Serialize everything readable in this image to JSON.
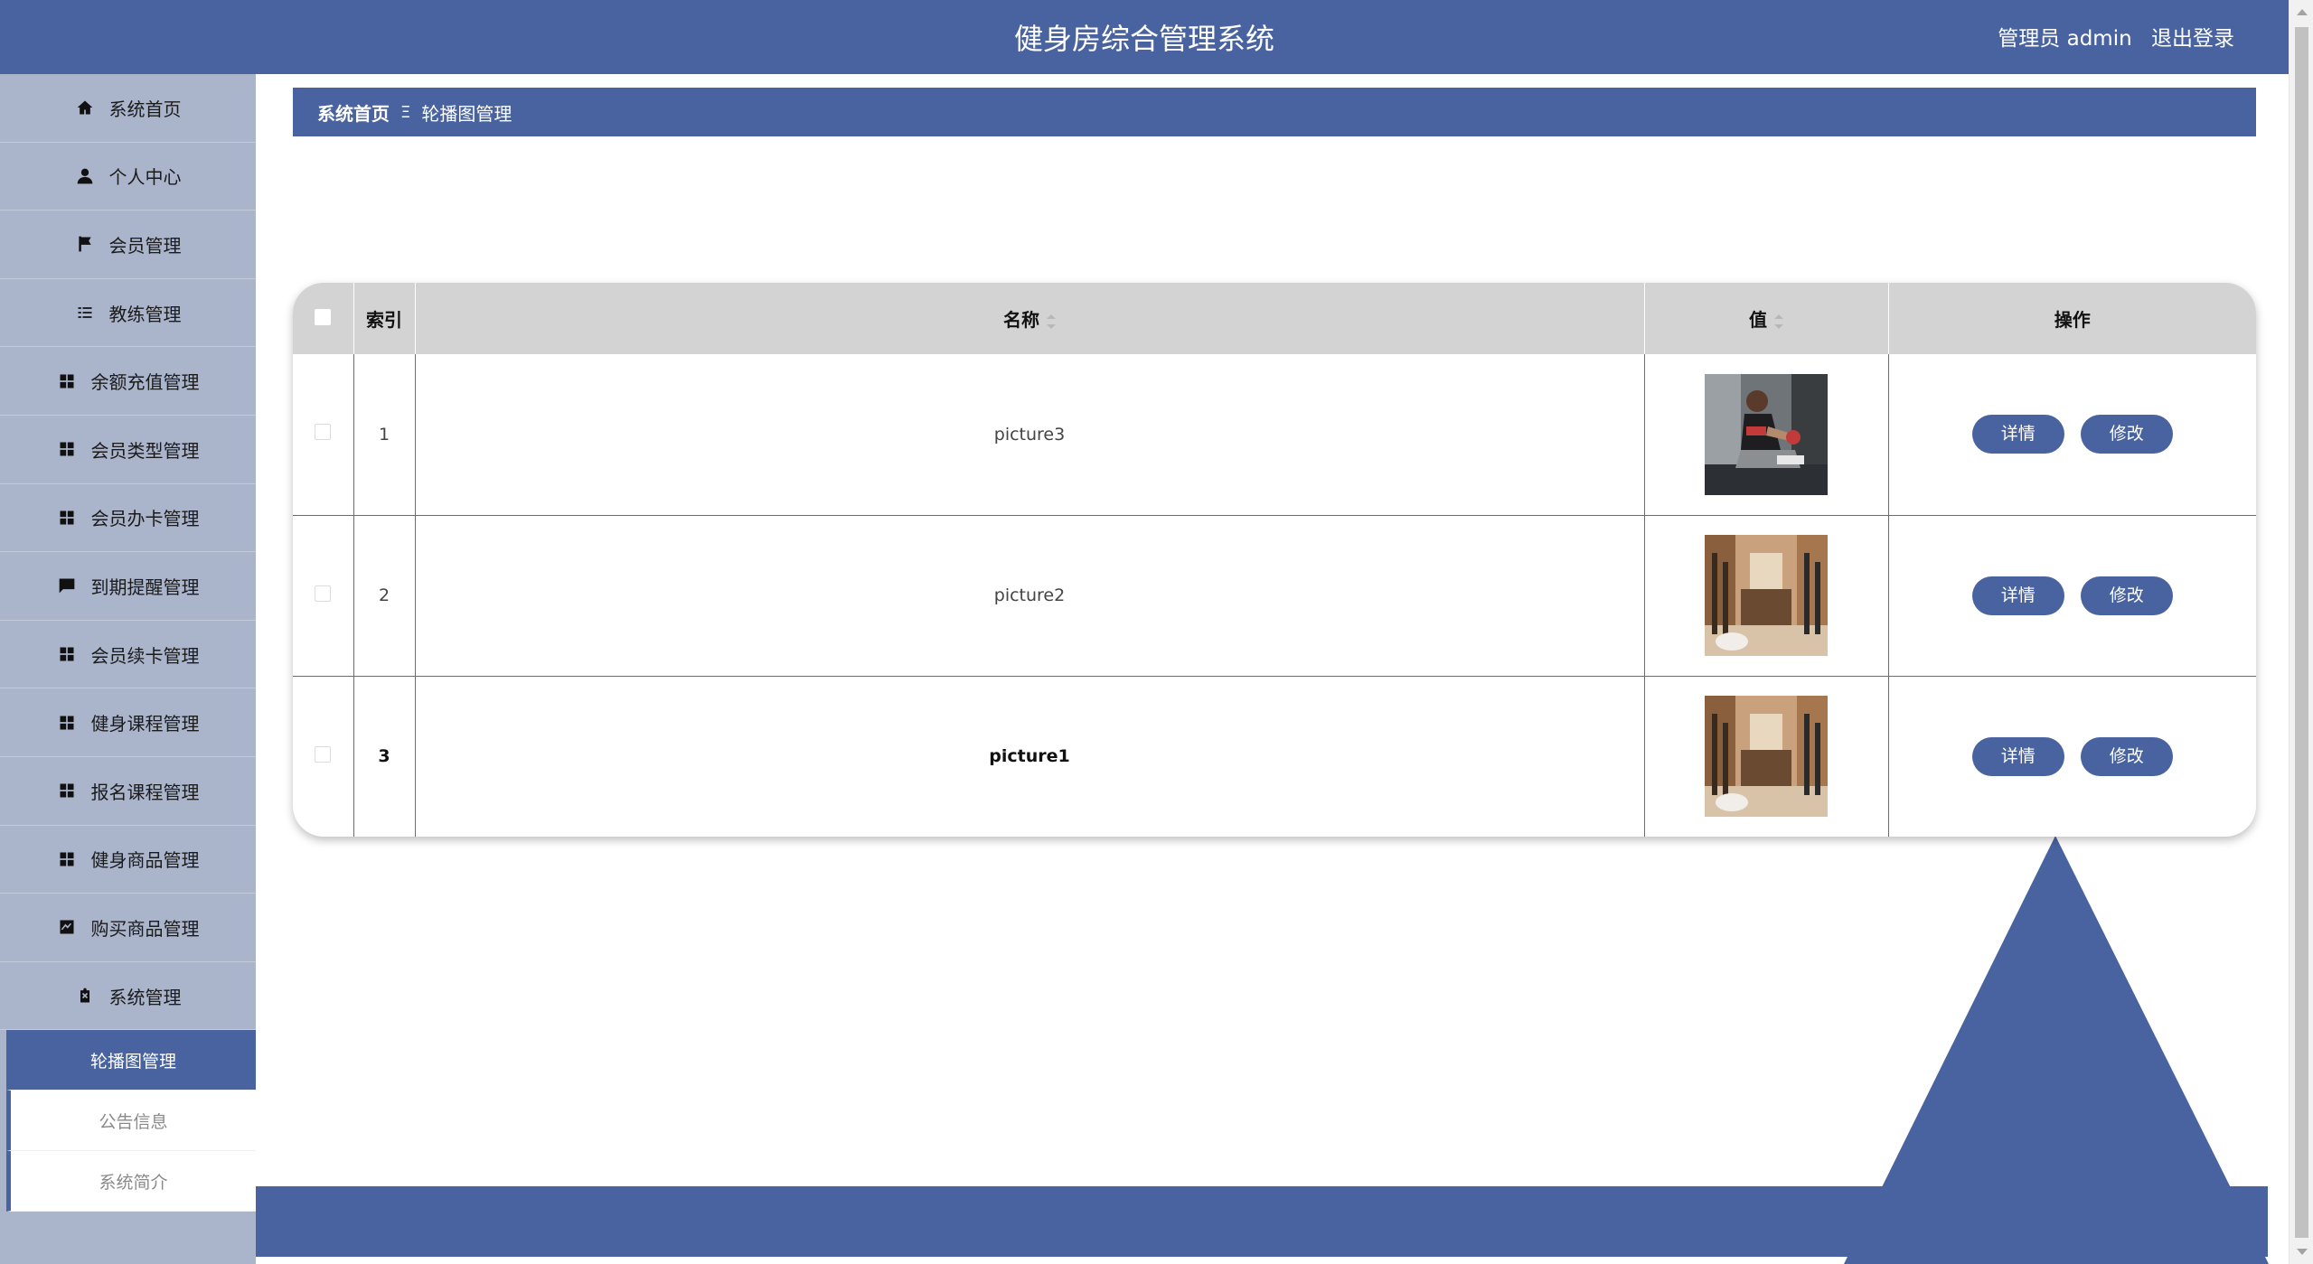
{
  "header": {
    "title": "健身房综合管理系统",
    "user_label": "管理员 admin",
    "logout": "退出登录"
  },
  "sidebar": {
    "items": [
      {
        "label": "系统首页",
        "icon": "home-icon"
      },
      {
        "label": "个人中心",
        "icon": "person-icon"
      },
      {
        "label": "会员管理",
        "icon": "flag-icon"
      },
      {
        "label": "教练管理",
        "icon": "list-icon"
      },
      {
        "label": "余额充值管理",
        "icon": "grid-icon"
      },
      {
        "label": "会员类型管理",
        "icon": "grid-icon"
      },
      {
        "label": "会员办卡管理",
        "icon": "grid-icon"
      },
      {
        "label": "到期提醒管理",
        "icon": "chat-icon"
      },
      {
        "label": "会员续卡管理",
        "icon": "grid-icon"
      },
      {
        "label": "健身课程管理",
        "icon": "grid-icon"
      },
      {
        "label": "报名课程管理",
        "icon": "grid-icon"
      },
      {
        "label": "健身商品管理",
        "icon": "grid-icon"
      },
      {
        "label": "购买商品管理",
        "icon": "chart-icon"
      },
      {
        "label": "系统管理",
        "icon": "clipboard-icon"
      }
    ],
    "submenu": [
      {
        "label": "轮播图管理",
        "active": true
      },
      {
        "label": "公告信息",
        "active": false
      },
      {
        "label": "系统简介",
        "active": false
      }
    ]
  },
  "breadcrumb": {
    "home": "系统首页",
    "separator": "Ξ",
    "current": "轮播图管理"
  },
  "table": {
    "columns": [
      "",
      "索引",
      "名称",
      "值",
      "操作"
    ],
    "rows": [
      {
        "index": "1",
        "name": "picture3",
        "image": "woman-boxing-photo"
      },
      {
        "index": "2",
        "name": "picture2",
        "image": "gym-interior-photo"
      },
      {
        "index": "3",
        "name": "picture1",
        "image": "gym-interior-photo"
      }
    ],
    "detail_label": "详情",
    "edit_label": "修改"
  },
  "colors": {
    "primary": "#4863a0",
    "sidebar_bg": "#aab4cb",
    "header_row": "#d3d3d3"
  }
}
